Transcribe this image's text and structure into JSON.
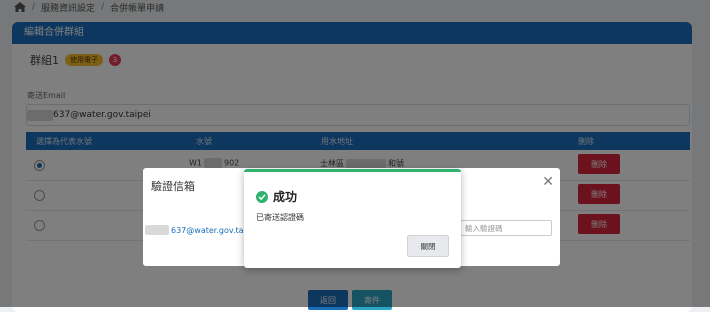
{
  "breadcrumb": {
    "item1": "服務資訊設定",
    "item2": "合併帳單申請"
  },
  "card": {
    "title": "編輯合併群組"
  },
  "group": {
    "name": "群組1",
    "status_badge": "使用電子",
    "count_badge": "3"
  },
  "email": {
    "label": "寄送Email",
    "value_suffix": "637@water.gov.taipei"
  },
  "table": {
    "headers": [
      "選擇為代表水號",
      "水號",
      "用水地址",
      "刪除"
    ],
    "rows": [
      {
        "selected": true,
        "water_no_prefix": "W1",
        "water_no_suffix": "902",
        "address_prefix": "士林區",
        "address_suffix": "和號",
        "delete": "刪除"
      },
      {
        "selected": false,
        "delete": "刪除"
      },
      {
        "selected": false,
        "delete": "刪除"
      }
    ]
  },
  "actions": {
    "back": "返回",
    "send": "寄件"
  },
  "verify_modal": {
    "title": "驗證信箱",
    "email_suffix": "637@water.gov.taipei",
    "code_placeholder": "輸入驗證碼"
  },
  "success_dialog": {
    "title": "成功",
    "message": "已寄送認證碼",
    "close": "關閉"
  },
  "colors": {
    "primary": "#1a6fbd",
    "danger": "#d8243c",
    "success": "#2fb26f"
  }
}
